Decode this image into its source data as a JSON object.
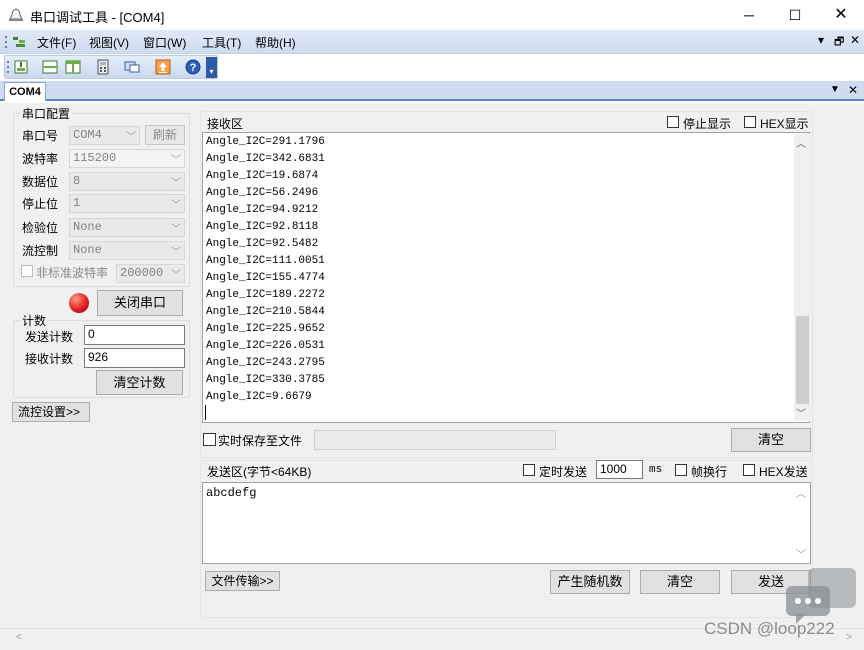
{
  "window": {
    "title": "串口调试工具 - [COM4]",
    "controls": {
      "minimize": "─",
      "maximize": "☐",
      "close": "✕"
    }
  },
  "menu": {
    "items": [
      "文件(F)",
      "视图(V)",
      "窗口(W)",
      "工具(T)",
      "帮助(H)"
    ],
    "mdi_controls": [
      "▾",
      "🗗",
      "✕"
    ]
  },
  "toolbar": {
    "icons": [
      "new-icon",
      "split-horizontal-icon",
      "split-vertical-icon",
      "calculator-icon",
      "monitor-icon",
      "upload-icon",
      "help-icon"
    ]
  },
  "tabs": {
    "active": "COM4",
    "controls": [
      "▼",
      "✕"
    ]
  },
  "serial_config": {
    "group_title": "串口配置",
    "port": {
      "label": "串口号",
      "value": "COM4",
      "refresh": "刷新"
    },
    "baud": {
      "label": "波特率",
      "value": "115200"
    },
    "data_bits": {
      "label": "数据位",
      "value": "8"
    },
    "stop_bits": {
      "label": "停止位",
      "value": "1"
    },
    "parity": {
      "label": "检验位",
      "value": "None"
    },
    "flow": {
      "label": "流控制",
      "value": "None"
    },
    "custom_baud": {
      "label": "非标准波特率",
      "value": "200000"
    },
    "close_port_button": "关闭串口",
    "status_color": "#e02020"
  },
  "counter": {
    "group_title": "计数",
    "send_label": "发送计数",
    "send_value": "0",
    "recv_label": "接收计数",
    "recv_value": "926",
    "clear_button": "清空计数"
  },
  "flow_settings_button": "流控设置>>",
  "receive": {
    "title": "接收区",
    "stop_display": "停止显示",
    "hex_display": "HEX显示",
    "lines": [
      "Angle_I2C=291.1796",
      "Angle_I2C=342.6831",
      "Angle_I2C=19.6874",
      "Angle_I2C=56.2496",
      "Angle_I2C=94.9212",
      "Angle_I2C=92.8118",
      "Angle_I2C=92.5482",
      "Angle_I2C=111.0051",
      "Angle_I2C=155.4774",
      "Angle_I2C=189.2272",
      "Angle_I2C=210.5844",
      "Angle_I2C=225.9652",
      "Angle_I2C=226.0531",
      "Angle_I2C=243.2795",
      "Angle_I2C=330.3785",
      "Angle_I2C=9.6679"
    ],
    "save_to_file": "实时保存至文件",
    "clear_button": "清空"
  },
  "send": {
    "title": "发送区(字节<64KB)",
    "timed_send": "定时发送",
    "interval_value": "1000",
    "interval_unit": "ms",
    "newline": "帧换行",
    "hex_send": "HEX发送",
    "content": "abcdefg",
    "file_transfer": "文件传输>>",
    "random": "产生随机数",
    "clear": "清空",
    "send": "发送"
  },
  "watermark": "CSDN @loop222"
}
